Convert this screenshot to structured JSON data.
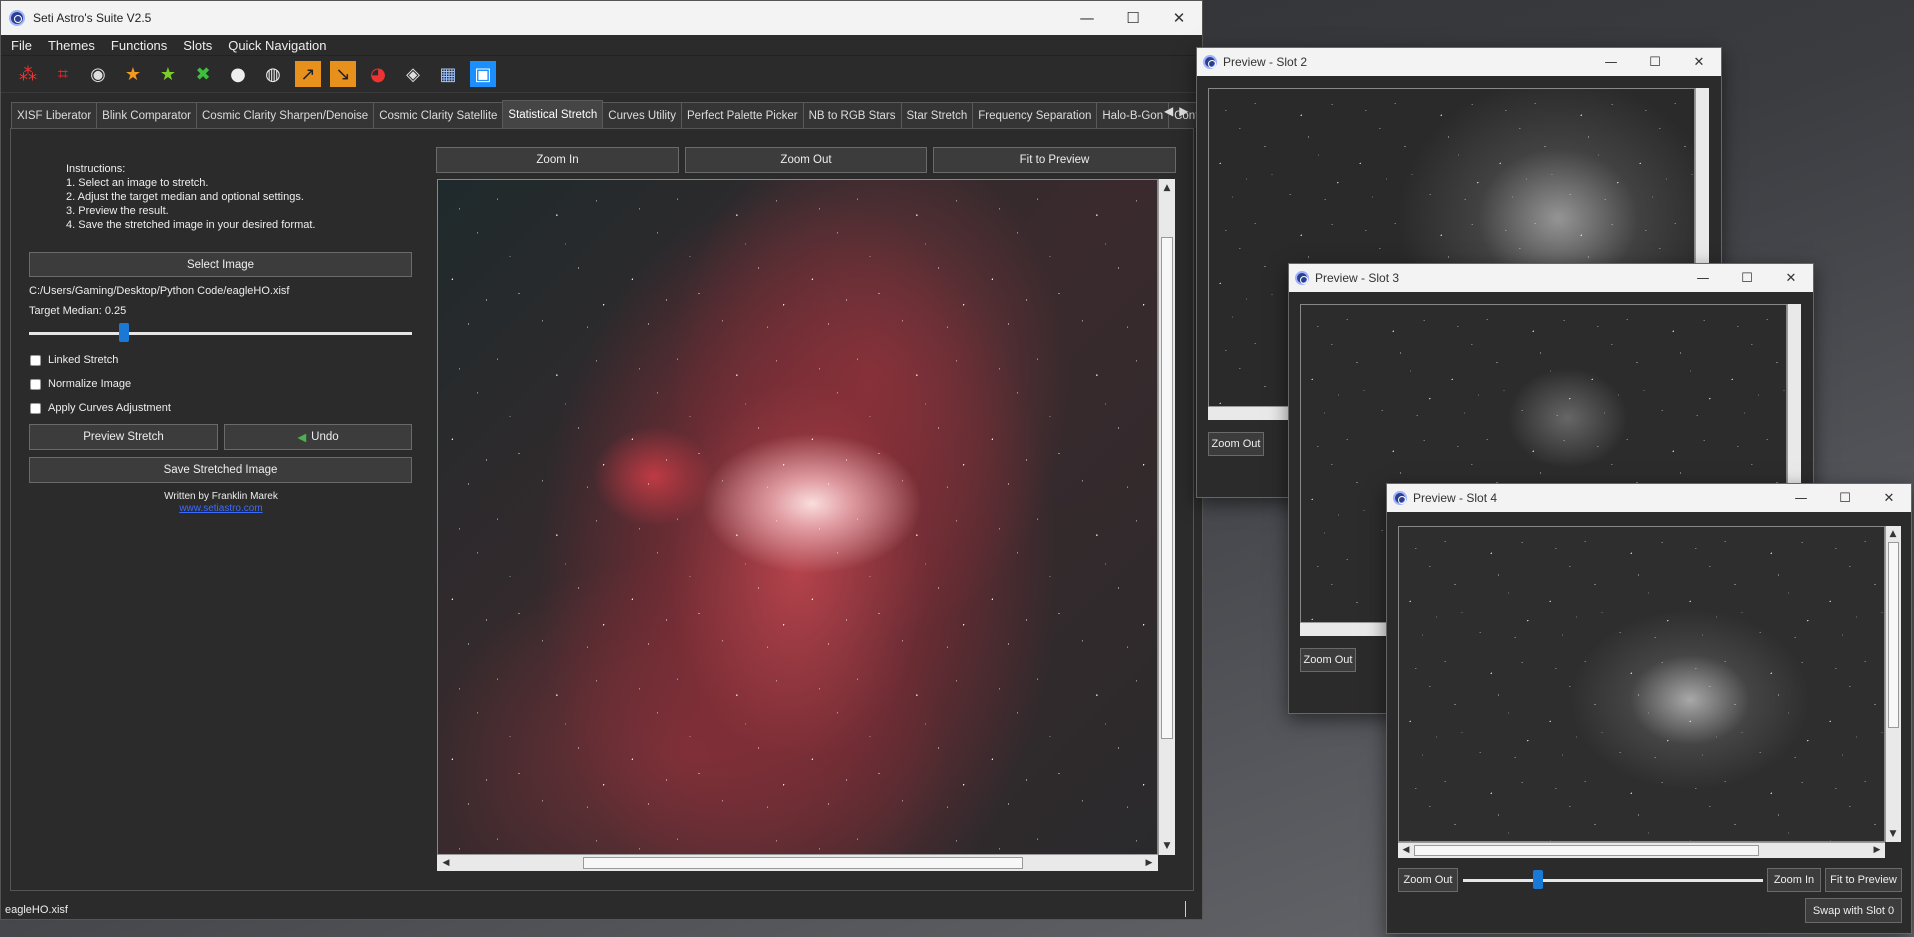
{
  "main_window": {
    "title": "Seti Astro's Suite V2.5",
    "controls": [
      "—",
      "☐",
      "✕"
    ]
  },
  "menu": [
    "File",
    "Themes",
    "Functions",
    "Slots",
    "Quick Navigation"
  ],
  "toolbar_icons": [
    "star-pair-icon",
    "crop-icon",
    "blink-icon",
    "star-orange-icon",
    "star-green-icon",
    "remove-green-icon",
    "cosmic-clarity-icon",
    "xisf-icon",
    "curves-icon",
    "curves-alt-icon",
    "rgb-combine-icon",
    "palette-icon",
    "grid-icon",
    "frame-icon"
  ],
  "tabs": [
    "XISF Liberator",
    "Blink Comparator",
    "Cosmic Clarity Sharpen/Denoise",
    "Cosmic Clarity Satellite",
    "Statistical Stretch",
    "Curves Utility",
    "Perfect Palette Picker",
    "NB to RGB Stars",
    "Star Stretch",
    "Frequency Separation",
    "Halo-B-Gon",
    "Continuum"
  ],
  "active_tab_index": 4,
  "stretch": {
    "instructions": [
      "Instructions:",
      "1. Select an image to stretch.",
      "2. Adjust the target median and optional settings.",
      "3. Preview the result.",
      "4. Save the stretched image in your desired format."
    ],
    "select_image": "Select Image",
    "file_path": "C:/Users/Gaming/Desktop/Python Code/eagleHO.xisf",
    "target_median_label": "Target Median: 0.25",
    "target_median": 0.25,
    "options": [
      "Linked Stretch",
      "Normalize Image",
      "Apply Curves Adjustment"
    ],
    "preview_stretch": "Preview Stretch",
    "undo": "Undo",
    "save": "Save Stretched Image",
    "written_by": "Written by Franklin Marek",
    "website": "www.setiastro.com"
  },
  "preview_controls": {
    "zoom_in": "Zoom In",
    "zoom_out": "Zoom Out",
    "fit": "Fit to Preview"
  },
  "status": "eagleHO.xisf",
  "slot2": {
    "title": "Preview - Slot 2",
    "zoom_out": "Zoom Out"
  },
  "slot3": {
    "title": "Preview - Slot 3",
    "zoom_out": "Zoom Out"
  },
  "slot4": {
    "title": "Preview - Slot 4",
    "zoom_out": "Zoom Out",
    "zoom_in": "Zoom In",
    "fit": "Fit to Preview",
    "swap": "Swap with Slot 0"
  }
}
